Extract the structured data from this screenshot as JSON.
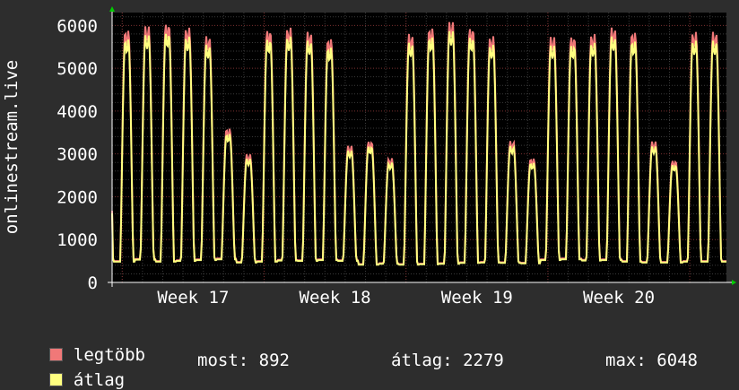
{
  "chart_data": {
    "type": "line",
    "ylabel": "onlinestream.live",
    "ylim": [
      0,
      6300
    ],
    "yticks": [
      0,
      1000,
      2000,
      3000,
      4000,
      5000,
      6000
    ],
    "xticks": [
      "Week 17",
      "Week 18",
      "Week 19",
      "Week 20"
    ],
    "day_peaks": [
      5900,
      6000,
      6050,
      5950,
      5750,
      3600,
      3000,
      5900,
      5950,
      5850,
      5700,
      3200,
      3300,
      2900,
      5800,
      5950,
      6100,
      5950,
      5750,
      3300,
      2900,
      5750,
      5750,
      5800,
      5950,
      5850,
      3300,
      2850,
      5850,
      5850
    ],
    "day_troughs": [
      500,
      550,
      500,
      520,
      540,
      560,
      480,
      500,
      530,
      520,
      540,
      520,
      430,
      450,
      430,
      440,
      450,
      470,
      480,
      470,
      460,
      540,
      560,
      530,
      540,
      500,
      480,
      480,
      500,
      500
    ],
    "series": [
      {
        "name": "legtöbb",
        "color": "#f07878"
      },
      {
        "name": "átlag",
        "color": "#ffff80"
      }
    ],
    "grid": true
  },
  "legend": {
    "max_label": "legtöbb",
    "avg_label": "átlag",
    "max_color": "#f07878",
    "avg_color": "#ffff80"
  },
  "stats": {
    "now": "most: 892",
    "avg": "átlag: 2279",
    "max": "max: 6048"
  }
}
